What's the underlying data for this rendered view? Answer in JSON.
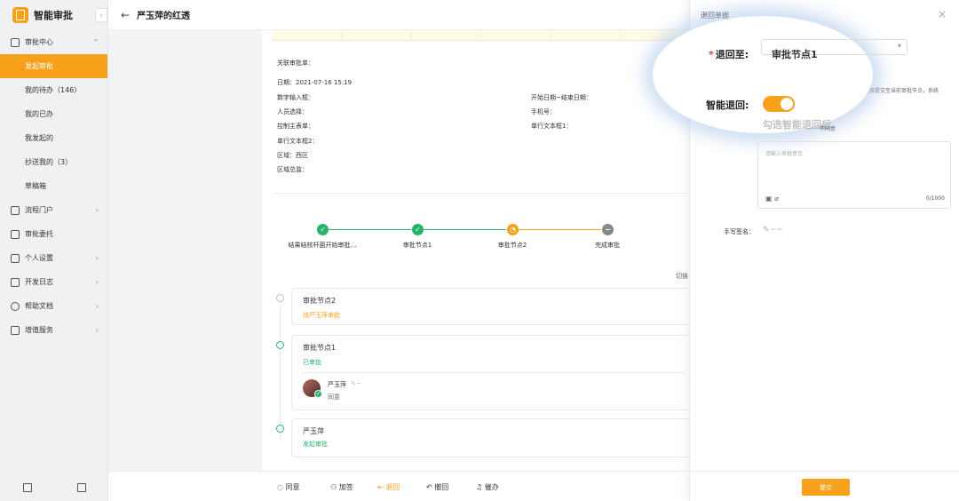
{
  "app": {
    "title": "智能审批",
    "collapse_icon": "chevron-left-icon"
  },
  "header": {
    "title": "严玉萍的红透"
  },
  "sidebar": {
    "groups": [
      {
        "label": "审批中心",
        "expanded": true,
        "children": [
          {
            "label": "发起审批",
            "active": true
          },
          {
            "label": "我的待办（146）"
          },
          {
            "label": "我的已办"
          },
          {
            "label": "我发起的"
          },
          {
            "label": "抄送我的（3）"
          },
          {
            "label": "草稿箱"
          }
        ]
      },
      {
        "label": "流程门户"
      },
      {
        "label": "审批委托"
      },
      {
        "label": "个人设置"
      },
      {
        "label": "开发日志"
      },
      {
        "label": "帮助文档"
      },
      {
        "label": "增值服务"
      }
    ]
  },
  "form": {
    "related": "关联审批单：",
    "date": "日期：2021-07-16 15:19",
    "number_input": "数字输入框：",
    "date_range": "开始日期~结束日期：",
    "person_select": "人员选择：",
    "phone": "手机号：",
    "control_table": "控制主表单：",
    "single_text1": "单行文本框1：",
    "single_text2": "单行文本框2：",
    "region": "区域：西区",
    "region_total": "区域总监："
  },
  "steps": [
    {
      "label": "结果结核杆菌开始审批…",
      "state": "done"
    },
    {
      "label": "审批节点1",
      "state": "done"
    },
    {
      "label": "审批节点2",
      "state": "current"
    },
    {
      "label": "完成审批",
      "state": "pending"
    }
  ],
  "switch_hint": "切换",
  "timeline": [
    {
      "title": "审批节点2",
      "status": "待严玉萍审批",
      "state": "pending"
    },
    {
      "title": "审批节点1",
      "status": "已审批",
      "state": "done",
      "approver": {
        "name": "严玉萍",
        "action": "同意"
      }
    },
    {
      "title": "严玉萍",
      "status": "发起审批",
      "state": "done"
    }
  ],
  "toolbar": {
    "agree": "同意",
    "add_sign": "加签",
    "return": "退回",
    "withdraw": "撤回",
    "remind": "催办"
  },
  "panel": {
    "title": "退回单据",
    "return_to_label": "退回至:",
    "return_to_value": "审批节点1",
    "smart_return_label": "智能退回:",
    "smart_return_on": true,
    "smart_return_hint": "勾选智能退回后",
    "side_note": "直接提交至当前审批节点，系统",
    "opinion_label": "不同意",
    "opinion_placeholder": "请输入审批意见",
    "char_count": "0/1000",
    "signature_label": "手写签名：",
    "submit": "提交"
  },
  "colors": {
    "accent": "#f7a11a",
    "success": "#27b36b",
    "pending": "#888888"
  }
}
